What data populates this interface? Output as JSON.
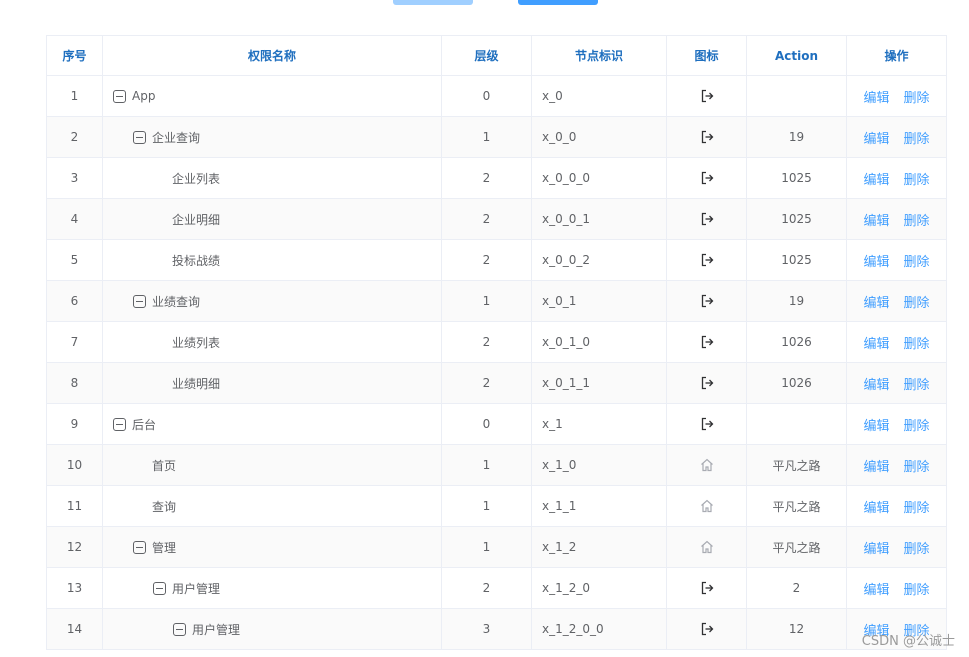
{
  "table": {
    "headers": [
      "序号",
      "权限名称",
      "层级",
      "节点标识",
      "图标",
      "Action",
      "操作"
    ],
    "rows": [
      {
        "no": "1",
        "name": "App",
        "level": "0",
        "code": "x_0",
        "icon": "logout-icon",
        "action": "",
        "depth": 0,
        "expandable": true
      },
      {
        "no": "2",
        "name": "企业查询",
        "level": "1",
        "code": "x_0_0",
        "icon": "logout-icon",
        "action": "19",
        "depth": 1,
        "expandable": true
      },
      {
        "no": "3",
        "name": "企业列表",
        "level": "2",
        "code": "x_0_0_0",
        "icon": "logout-icon",
        "action": "1025",
        "depth": 2,
        "expandable": false
      },
      {
        "no": "4",
        "name": "企业明细",
        "level": "2",
        "code": "x_0_0_1",
        "icon": "logout-icon",
        "action": "1025",
        "depth": 2,
        "expandable": false
      },
      {
        "no": "5",
        "name": "投标战绩",
        "level": "2",
        "code": "x_0_0_2",
        "icon": "logout-icon",
        "action": "1025",
        "depth": 2,
        "expandable": false
      },
      {
        "no": "6",
        "name": "业绩查询",
        "level": "1",
        "code": "x_0_1",
        "icon": "logout-icon",
        "action": "19",
        "depth": 1,
        "expandable": true
      },
      {
        "no": "7",
        "name": "业绩列表",
        "level": "2",
        "code": "x_0_1_0",
        "icon": "logout-icon",
        "action": "1026",
        "depth": 2,
        "expandable": false
      },
      {
        "no": "8",
        "name": "业绩明细",
        "level": "2",
        "code": "x_0_1_1",
        "icon": "logout-icon",
        "action": "1026",
        "depth": 2,
        "expandable": false
      },
      {
        "no": "9",
        "name": "后台",
        "level": "0",
        "code": "x_1",
        "icon": "logout-icon",
        "action": "",
        "depth": 0,
        "expandable": true
      },
      {
        "no": "10",
        "name": "首页",
        "level": "1",
        "code": "x_1_0",
        "icon": "home-icon",
        "action": "平凡之路",
        "depth": 1,
        "expandable": false
      },
      {
        "no": "11",
        "name": "查询",
        "level": "1",
        "code": "x_1_1",
        "icon": "home-icon",
        "action": "平凡之路",
        "depth": 1,
        "expandable": false
      },
      {
        "no": "12",
        "name": "管理",
        "level": "1",
        "code": "x_1_2",
        "icon": "home-icon",
        "action": "平凡之路",
        "depth": 1,
        "expandable": true
      },
      {
        "no": "13",
        "name": "用户管理",
        "level": "2",
        "code": "x_1_2_0",
        "icon": "logout-icon",
        "action": "2",
        "depth": 2,
        "expandable": true
      },
      {
        "no": "14",
        "name": "用户管理",
        "level": "3",
        "code": "x_1_2_0_0",
        "icon": "logout-icon",
        "action": "12",
        "depth": 3,
        "expandable": true
      }
    ],
    "ops": {
      "edit": "编辑",
      "delete": "删除"
    }
  },
  "watermark": "CSDN @公诚士"
}
